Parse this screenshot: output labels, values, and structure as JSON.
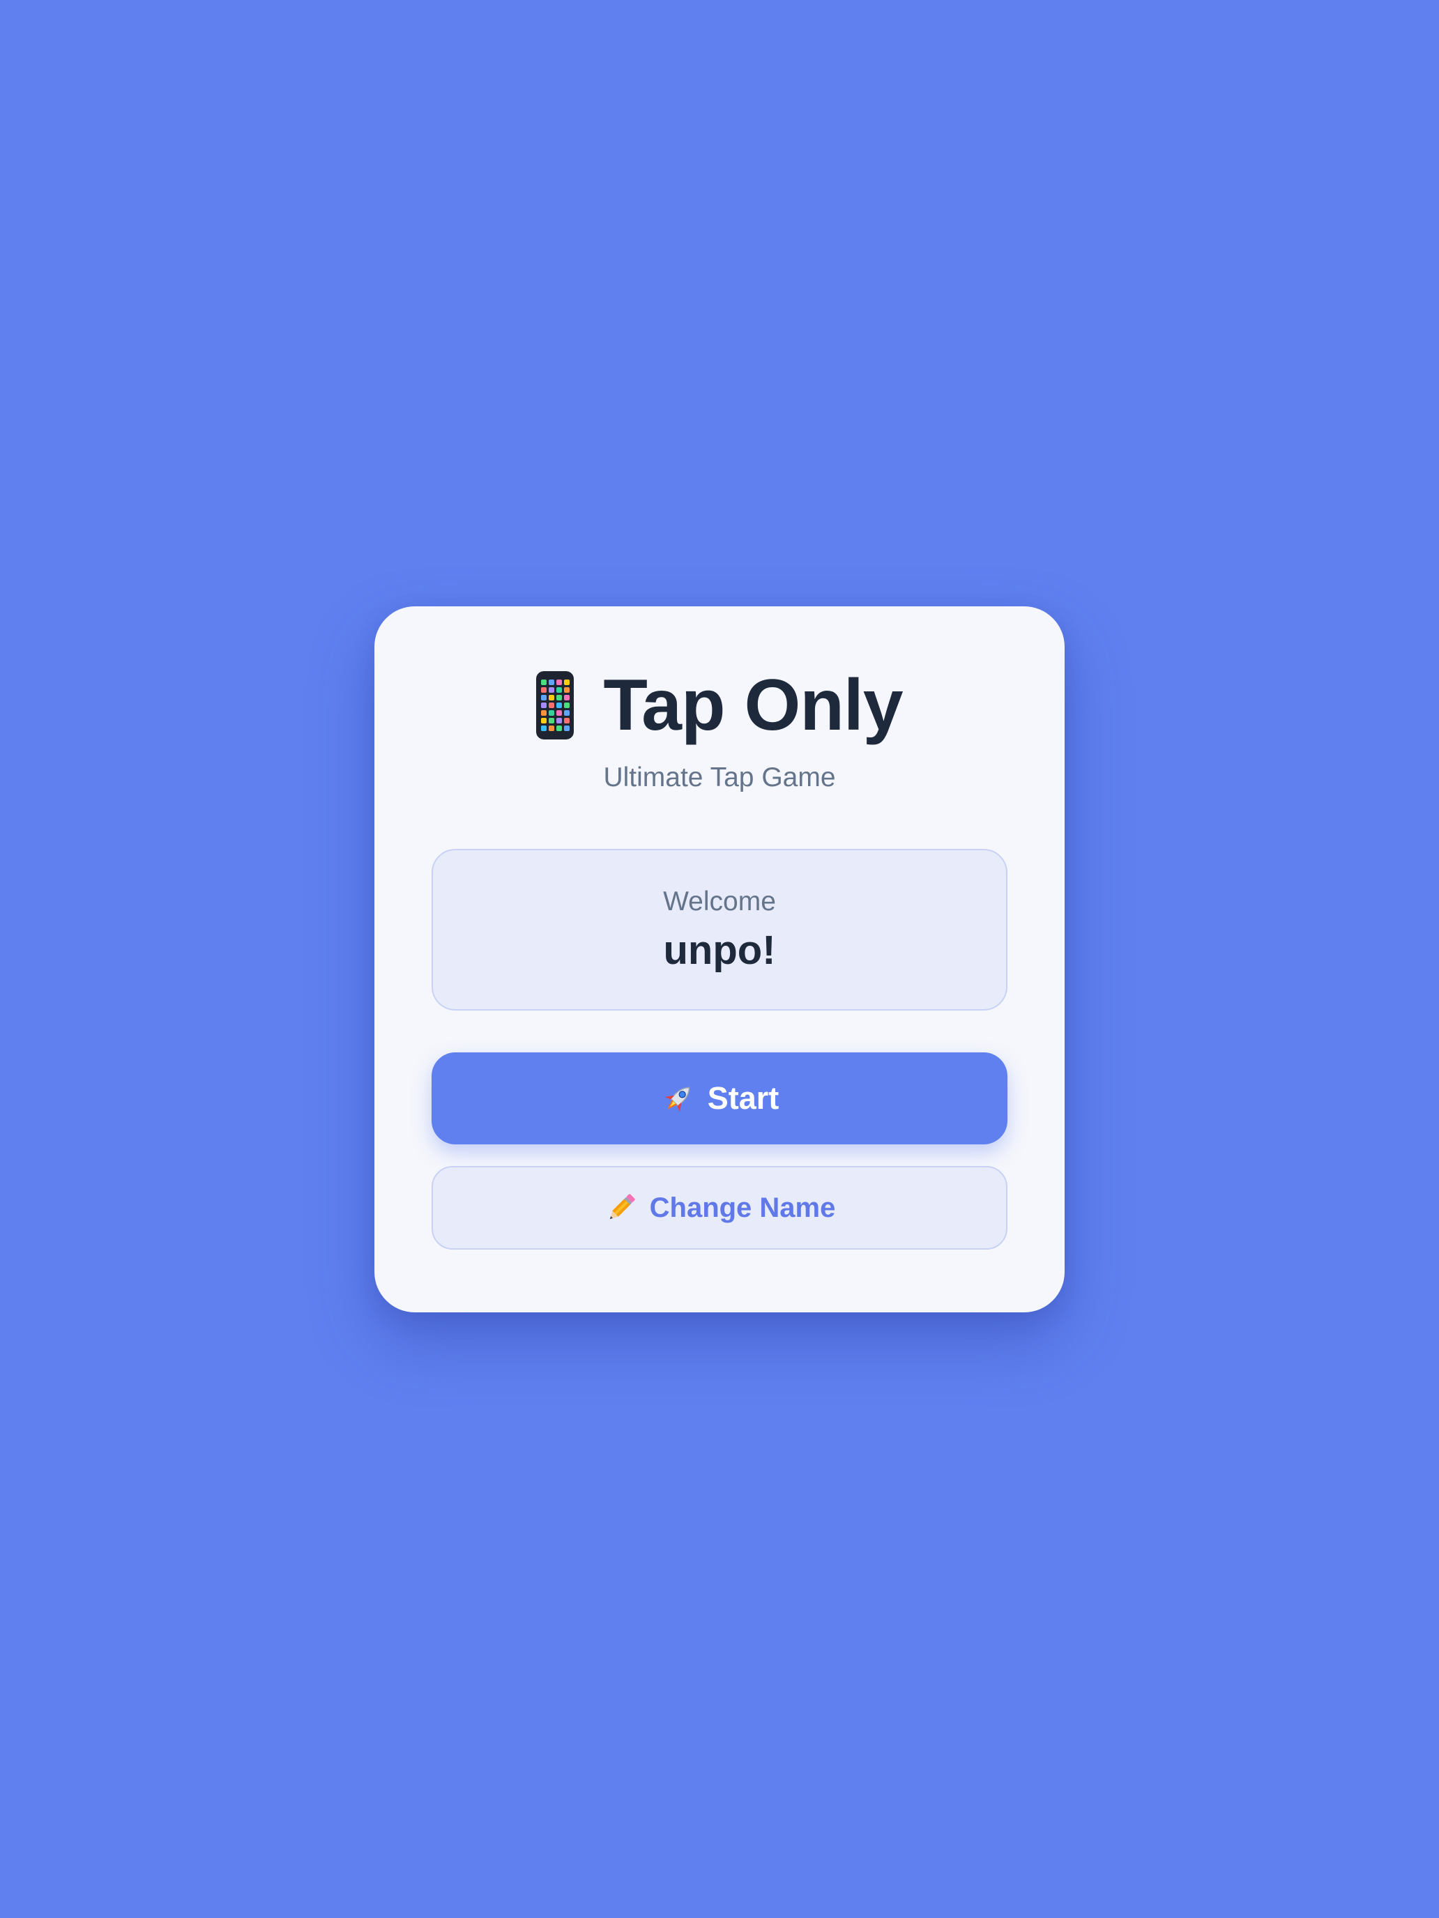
{
  "app": {
    "title": "Tap Only",
    "subtitle": "Ultimate Tap Game",
    "title_icon": "mobile-phone-icon"
  },
  "welcome": {
    "label": "Welcome",
    "name": "unpo!"
  },
  "buttons": {
    "start_label": "Start",
    "start_icon": "rocket-icon",
    "change_name_label": "Change Name",
    "change_name_icon": "pencil-icon"
  },
  "colors": {
    "background": "#6080f0",
    "card": "#f6f7fc",
    "accent": "#6080f0",
    "text_dark": "#1e293b",
    "text_muted": "#64748b"
  }
}
